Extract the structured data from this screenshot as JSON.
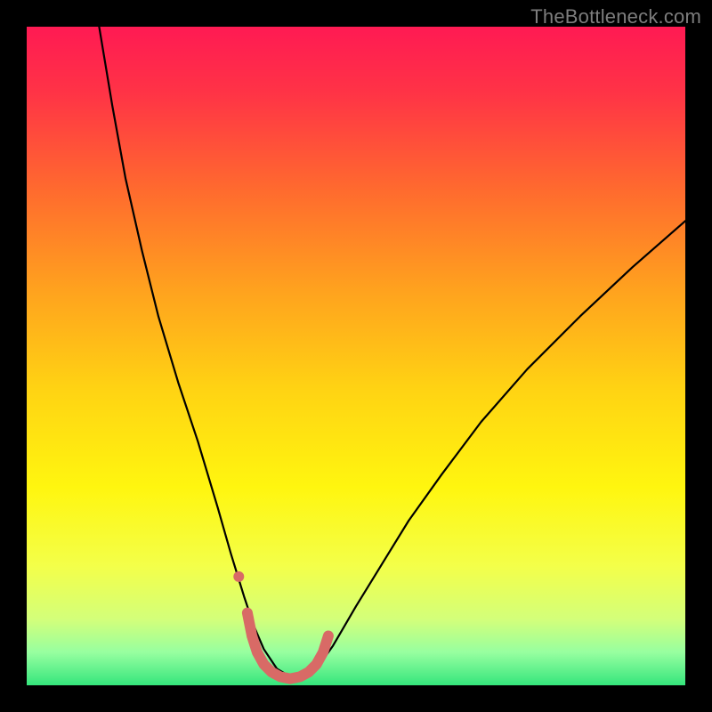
{
  "watermark": "TheBottleneck.com",
  "chart_data": {
    "type": "line",
    "title": "",
    "xlabel": "",
    "ylabel": "",
    "xlim": [
      0,
      100
    ],
    "ylim": [
      0,
      100
    ],
    "grid": false,
    "legend": false,
    "background_gradient": {
      "stops": [
        {
          "offset": 0.0,
          "color": "#ff1a53"
        },
        {
          "offset": 0.1,
          "color": "#ff3346"
        },
        {
          "offset": 0.25,
          "color": "#ff6b2e"
        },
        {
          "offset": 0.4,
          "color": "#ffa21e"
        },
        {
          "offset": 0.55,
          "color": "#ffd313"
        },
        {
          "offset": 0.7,
          "color": "#fff60f"
        },
        {
          "offset": 0.82,
          "color": "#f3ff4a"
        },
        {
          "offset": 0.9,
          "color": "#d3ff7a"
        },
        {
          "offset": 0.95,
          "color": "#97ffa0"
        },
        {
          "offset": 1.0,
          "color": "#35e57c"
        }
      ]
    },
    "series": [
      {
        "name": "curve",
        "stroke": "#000000",
        "stroke_width": 2.2,
        "x": [
          11.0,
          13.0,
          15.0,
          17.5,
          20.0,
          23.0,
          26.0,
          29.0,
          31.0,
          33.0,
          34.5,
          36.0,
          38.0,
          40.0,
          42.0,
          44.0,
          46.5,
          50.0,
          54.0,
          58.0,
          63.0,
          69.0,
          76.0,
          84.0,
          92.0,
          100.0
        ],
        "y": [
          100.0,
          88.0,
          77.0,
          66.0,
          56.0,
          46.0,
          37.0,
          27.0,
          20.0,
          13.5,
          9.0,
          5.5,
          2.5,
          1.3,
          1.3,
          2.5,
          6.0,
          12.0,
          18.5,
          25.0,
          32.0,
          40.0,
          48.0,
          56.0,
          63.5,
          70.5
        ]
      },
      {
        "name": "highlight",
        "stroke": "#d86a66",
        "stroke_width": 12,
        "x": [
          33.5,
          34.2,
          35.0,
          36.0,
          37.2,
          38.5,
          40.0,
          41.5,
          42.8,
          44.0,
          45.0,
          45.8
        ],
        "y": [
          11.0,
          7.5,
          5.0,
          3.2,
          2.0,
          1.3,
          1.0,
          1.3,
          2.0,
          3.2,
          5.0,
          7.5
        ]
      },
      {
        "name": "highlight-dot",
        "type": "scatter",
        "fill": "#d86a66",
        "r": 6,
        "x": [
          32.2
        ],
        "y": [
          16.5
        ]
      }
    ]
  }
}
